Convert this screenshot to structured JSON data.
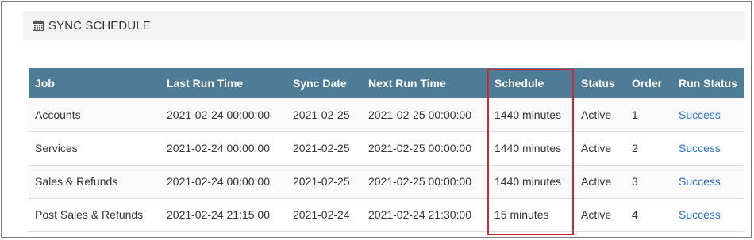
{
  "panel": {
    "title": "SYNC SCHEDULE",
    "icon": "calendar-icon"
  },
  "table": {
    "columns": [
      "Job",
      "Last Run Time",
      "Sync Date",
      "Next Run Time",
      "Schedule",
      "Status",
      "Order",
      "Run Status"
    ],
    "rows": [
      {
        "job": "Accounts",
        "last_run": "2021-02-24 00:00:00",
        "sync_date": "2021-02-25",
        "next_run": "2021-02-25 00:00:00",
        "schedule": "1440 minutes",
        "status": "Active",
        "order": "1",
        "run_status": "Success"
      },
      {
        "job": "Services",
        "last_run": "2021-02-24 00:00:00",
        "sync_date": "2021-02-25",
        "next_run": "2021-02-25 00:00:00",
        "schedule": "1440 minutes",
        "status": "Active",
        "order": "2",
        "run_status": "Success"
      },
      {
        "job": "Sales & Refunds",
        "last_run": "2021-02-24 00:00:00",
        "sync_date": "2021-02-25",
        "next_run": "2021-02-25 00:00:00",
        "schedule": "1440 minutes",
        "status": "Active",
        "order": "3",
        "run_status": "Success"
      },
      {
        "job": "Post Sales & Refunds",
        "last_run": "2021-02-24 21:15:00",
        "sync_date": "2021-02-24",
        "next_run": "2021-02-24 21:30:00",
        "schedule": "15 minutes",
        "status": "Active",
        "order": "4",
        "run_status": "Success"
      }
    ]
  },
  "colors": {
    "header_bg": "#4e7b96",
    "link": "#2a6fc9",
    "highlight": "#d9262c"
  }
}
